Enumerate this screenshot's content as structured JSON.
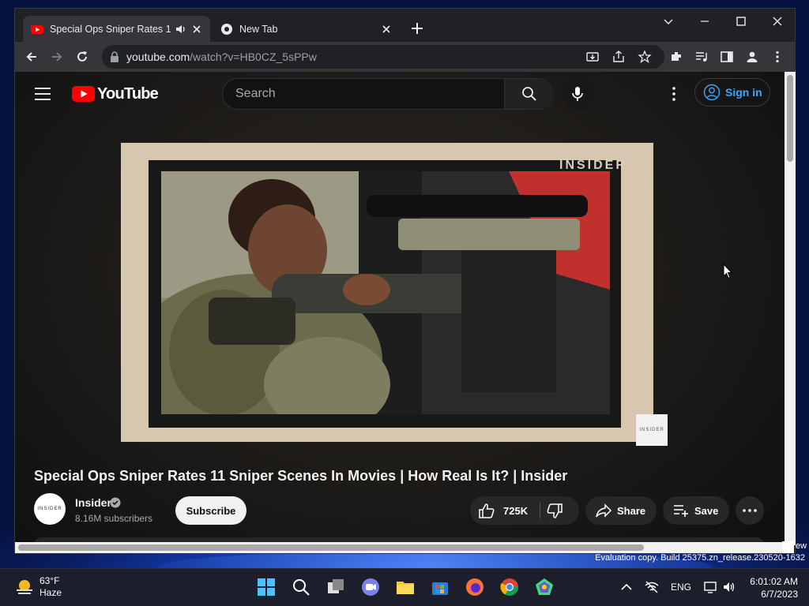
{
  "browser": {
    "tabs": [
      {
        "title": "Special Ops Sniper Rates 11 Sniper Scenes In Movies | How Real Is It? | Insider",
        "active": true
      },
      {
        "title": "New Tab",
        "active": false
      }
    ],
    "url_host": "youtube.com",
    "url_path": "/watch?v=HB0CZ_5sPPw"
  },
  "youtube": {
    "logo_text": "YouTube",
    "search_placeholder": "Search",
    "sign_in_label": "Sign in",
    "video": {
      "watermark": "INSIDER",
      "badge": "INSIDER",
      "title": "Special Ops Sniper Rates 11 Sniper Scenes In Movies | How Real Is It? | Insider"
    },
    "channel": {
      "avatar_text": "INSIDER",
      "name": "Insider",
      "subscribers": "8.16M subscribers"
    },
    "subscribe_label": "Subscribe",
    "like_count": "725K",
    "share_label": "Share",
    "save_label": "Save"
  },
  "desktop": {
    "watermark": "Evaluation copy. Build 25375.zn_release.230520-1632",
    "side_text": "ew"
  },
  "taskbar": {
    "weather_temp": "63°F",
    "weather_cond": "Haze",
    "language": "ENG",
    "time": "6:01:02 AM",
    "date": "6/7/2023"
  },
  "colors": {
    "accent_blue": "#3ea6ff",
    "youtube_red": "#ff0000",
    "taskbar_indicator": "#60cdff"
  }
}
